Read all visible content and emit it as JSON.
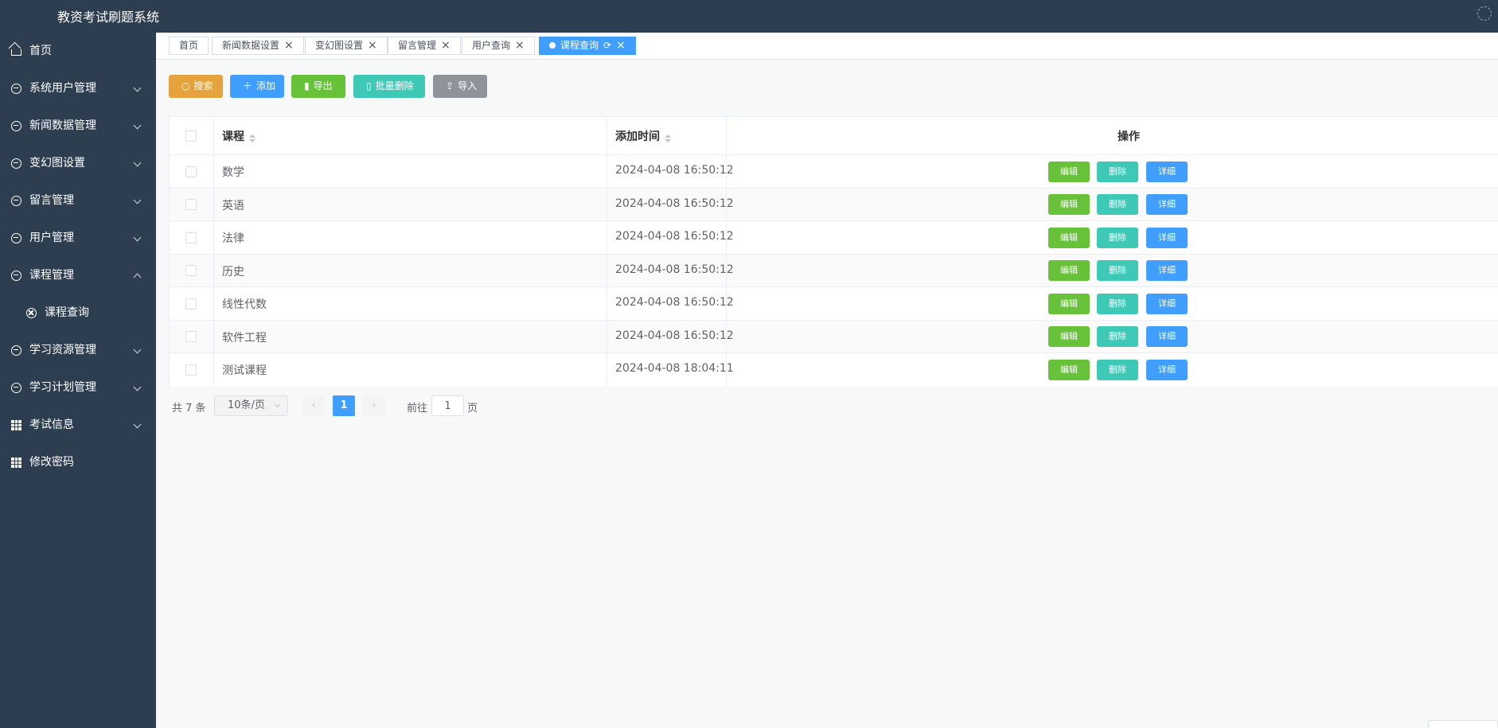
{
  "app": {
    "title": "教资考试刷题系统"
  },
  "sidebar": {
    "items": [
      {
        "label": "首页",
        "icon": "home-icon"
      },
      {
        "label": "系统用户管理",
        "icon": "circle-icon"
      },
      {
        "label": "新闻数据管理",
        "icon": "circle-icon"
      },
      {
        "label": "变幻图设置",
        "icon": "circle-icon"
      },
      {
        "label": "留言管理",
        "icon": "circle-icon"
      },
      {
        "label": "用户管理",
        "icon": "circle-icon"
      },
      {
        "label": "课程管理",
        "icon": "circle-icon",
        "expanded": true
      },
      {
        "label": "课程查询",
        "icon": "compass-icon",
        "submenu": true
      },
      {
        "label": "学习资源管理",
        "icon": "circle-icon"
      },
      {
        "label": "学习计划管理",
        "icon": "circle-icon"
      },
      {
        "label": "考试信息",
        "icon": "grid-icon"
      },
      {
        "label": "修改密码",
        "icon": "grid-icon"
      }
    ]
  },
  "tabs": [
    {
      "label": "首页"
    },
    {
      "label": "新闻数据设置"
    },
    {
      "label": "变幻图设置"
    },
    {
      "label": "留言管理"
    },
    {
      "label": "用户查询"
    },
    {
      "label": "课程查询",
      "active": true
    }
  ],
  "toolbar": {
    "search": "搜索",
    "add": "添加",
    "export": "导出",
    "batch_delete": "批量删除",
    "import": "导入"
  },
  "colors": {
    "search": "#e6a23c",
    "add": "#409eff",
    "export": "#67c23a",
    "batch_delete": "#3dc9b6",
    "import": "#909399"
  },
  "table": {
    "columns": {
      "course": "课程",
      "added_time": "添加时间",
      "actions": "操作"
    },
    "actions": {
      "edit": "编辑",
      "delete": "删除",
      "detail": "详细"
    },
    "rows": [
      {
        "course": "数学",
        "added_time": "2024-04-08 16:50:12"
      },
      {
        "course": "英语",
        "added_time": "2024-04-08 16:50:12"
      },
      {
        "course": "法律",
        "added_time": "2024-04-08 16:50:12"
      },
      {
        "course": "历史",
        "added_time": "2024-04-08 16:50:12"
      },
      {
        "course": "线性代数",
        "added_time": "2024-04-08 16:50:12"
      },
      {
        "course": "软件工程",
        "added_time": "2024-04-08 16:50:12"
      },
      {
        "course": "测试课程",
        "added_time": "2024-04-08 18:04:11"
      }
    ]
  },
  "pagination": {
    "total": "共 7 条",
    "page_size": "10条/页",
    "current_page": "1",
    "goto_label": "前往",
    "goto_value": "1",
    "page_suffix": "页"
  }
}
